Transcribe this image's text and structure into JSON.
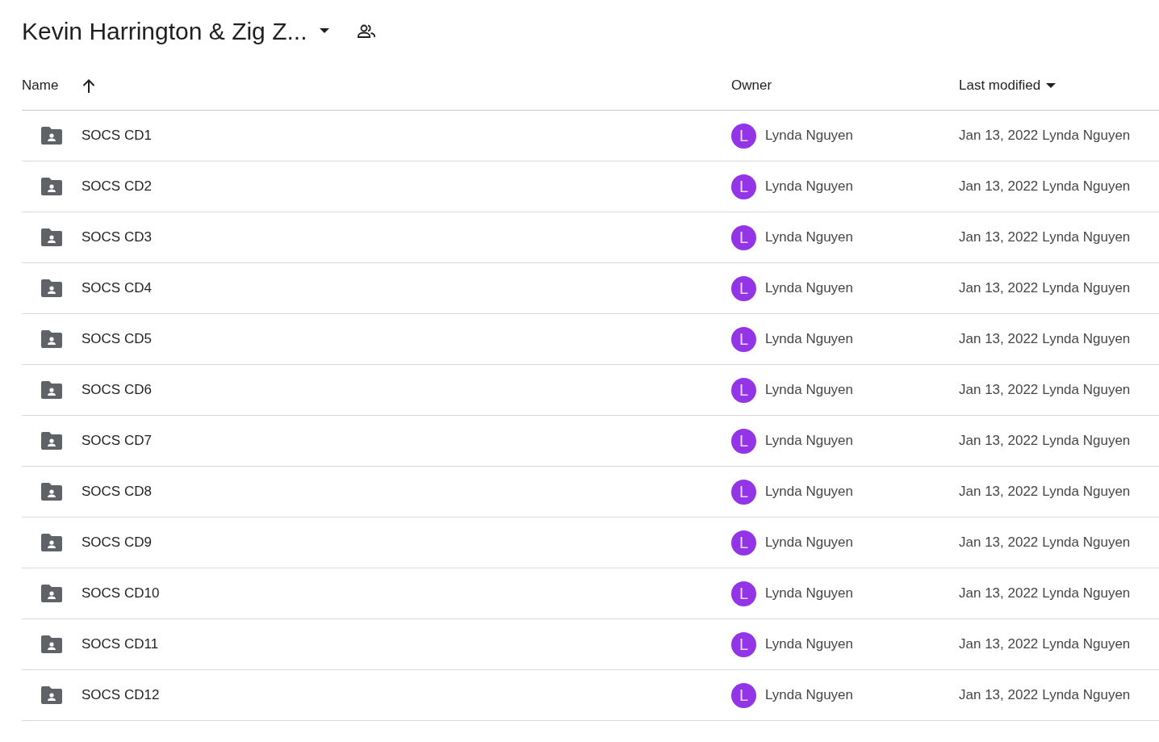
{
  "folder_title": "Kevin Harrington & Zig Z...",
  "columns": {
    "name": "Name",
    "owner": "Owner",
    "last_modified": "Last modified"
  },
  "rows": [
    {
      "name": "SOCS CD1",
      "owner_initial": "L",
      "owner": "Lynda Nguyen",
      "date": "Jan 13, 2022",
      "modified_by": "Lynda Nguyen"
    },
    {
      "name": "SOCS CD2",
      "owner_initial": "L",
      "owner": "Lynda Nguyen",
      "date": "Jan 13, 2022",
      "modified_by": "Lynda Nguyen"
    },
    {
      "name": "SOCS CD3",
      "owner_initial": "L",
      "owner": "Lynda Nguyen",
      "date": "Jan 13, 2022",
      "modified_by": "Lynda Nguyen"
    },
    {
      "name": "SOCS CD4",
      "owner_initial": "L",
      "owner": "Lynda Nguyen",
      "date": "Jan 13, 2022",
      "modified_by": "Lynda Nguyen"
    },
    {
      "name": "SOCS CD5",
      "owner_initial": "L",
      "owner": "Lynda Nguyen",
      "date": "Jan 13, 2022",
      "modified_by": "Lynda Nguyen"
    },
    {
      "name": "SOCS CD6",
      "owner_initial": "L",
      "owner": "Lynda Nguyen",
      "date": "Jan 13, 2022",
      "modified_by": "Lynda Nguyen"
    },
    {
      "name": "SOCS CD7",
      "owner_initial": "L",
      "owner": "Lynda Nguyen",
      "date": "Jan 13, 2022",
      "modified_by": "Lynda Nguyen"
    },
    {
      "name": "SOCS CD8",
      "owner_initial": "L",
      "owner": "Lynda Nguyen",
      "date": "Jan 13, 2022",
      "modified_by": "Lynda Nguyen"
    },
    {
      "name": "SOCS CD9",
      "owner_initial": "L",
      "owner": "Lynda Nguyen",
      "date": "Jan 13, 2022",
      "modified_by": "Lynda Nguyen"
    },
    {
      "name": "SOCS CD10",
      "owner_initial": "L",
      "owner": "Lynda Nguyen",
      "date": "Jan 13, 2022",
      "modified_by": "Lynda Nguyen"
    },
    {
      "name": "SOCS CD11",
      "owner_initial": "L",
      "owner": "Lynda Nguyen",
      "date": "Jan 13, 2022",
      "modified_by": "Lynda Nguyen"
    },
    {
      "name": "SOCS CD12",
      "owner_initial": "L",
      "owner": "Lynda Nguyen",
      "date": "Jan 13, 2022",
      "modified_by": "Lynda Nguyen"
    }
  ]
}
